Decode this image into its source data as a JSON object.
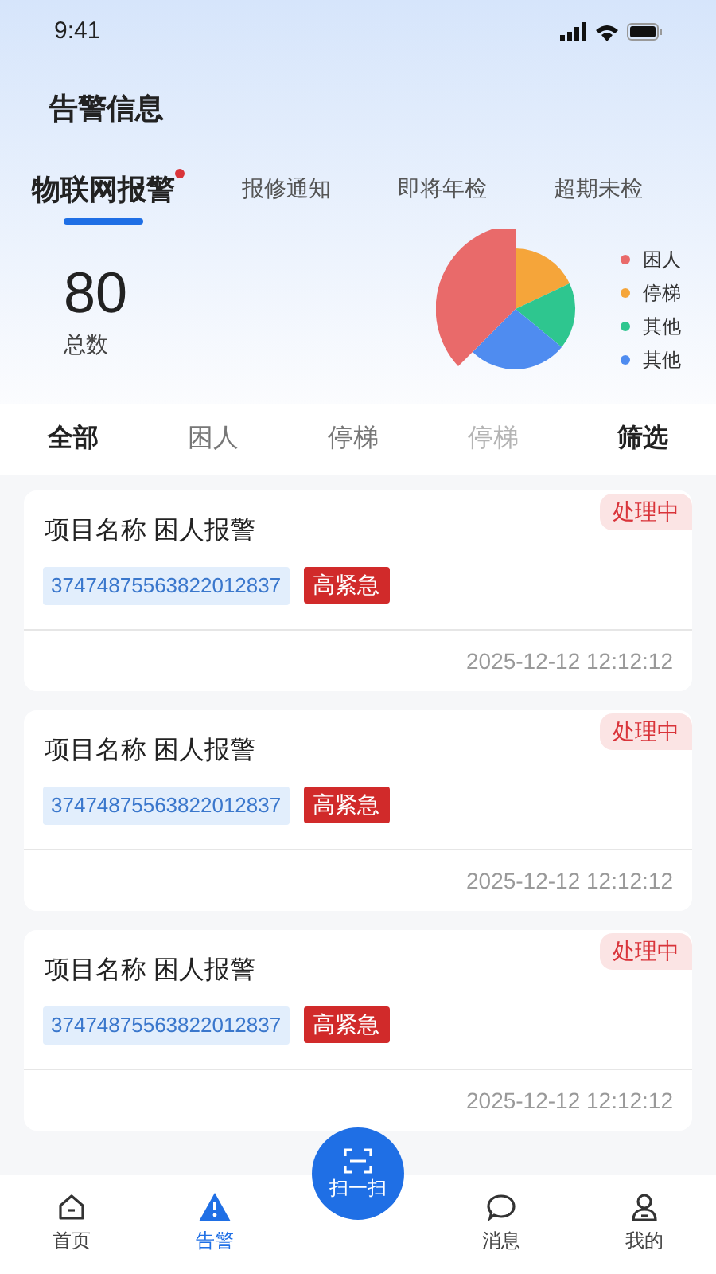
{
  "status_bar": {
    "time": "9:41"
  },
  "title": "告警信息",
  "tabs": [
    {
      "label": "物联网报警",
      "selected": true,
      "dot": true
    },
    {
      "label": "报修通知",
      "selected": false,
      "dot": false
    },
    {
      "label": "即将年检",
      "selected": false,
      "dot": false
    },
    {
      "label": "超期未检",
      "selected": false,
      "dot": false
    }
  ],
  "summary": {
    "total": "80",
    "total_label": "总数"
  },
  "legend": [
    {
      "label": "困人",
      "color": "#e96a6a"
    },
    {
      "label": "停梯",
      "color": "#f5a53a"
    },
    {
      "label": "其他",
      "color": "#2ec68f"
    },
    {
      "label": "其他",
      "color": "#4f8cf0"
    }
  ],
  "filters": [
    {
      "label": "全部",
      "selected": true,
      "faded": false
    },
    {
      "label": "困人",
      "selected": false,
      "faded": false
    },
    {
      "label": "停梯",
      "selected": false,
      "faded": false
    },
    {
      "label": "停梯",
      "selected": false,
      "faded": true
    }
  ],
  "filter_button": "筛选",
  "alarms": [
    {
      "title": "项目名称 困人报警",
      "status": "处理中",
      "code": "37474875563822012837",
      "urgency": "高紧急",
      "time": "2025-12-12 12:12:12"
    },
    {
      "title": "项目名称 困人报警",
      "status": "处理中",
      "code": "37474875563822012837",
      "urgency": "高紧急",
      "time": "2025-12-12 12:12:12"
    },
    {
      "title": "项目名称 困人报警",
      "status": "处理中",
      "code": "37474875563822012837",
      "urgency": "高紧急",
      "time": "2025-12-12 12:12:12"
    }
  ],
  "nav": [
    {
      "kind": "home",
      "label": "首页",
      "selected": false
    },
    {
      "kind": "alert",
      "label": "告警",
      "selected": true
    },
    {
      "kind": "scan",
      "label": "扫一扫",
      "selected": false
    },
    {
      "kind": "message",
      "label": "消息",
      "selected": false
    },
    {
      "kind": "profile",
      "label": "我的",
      "selected": false
    }
  ]
}
